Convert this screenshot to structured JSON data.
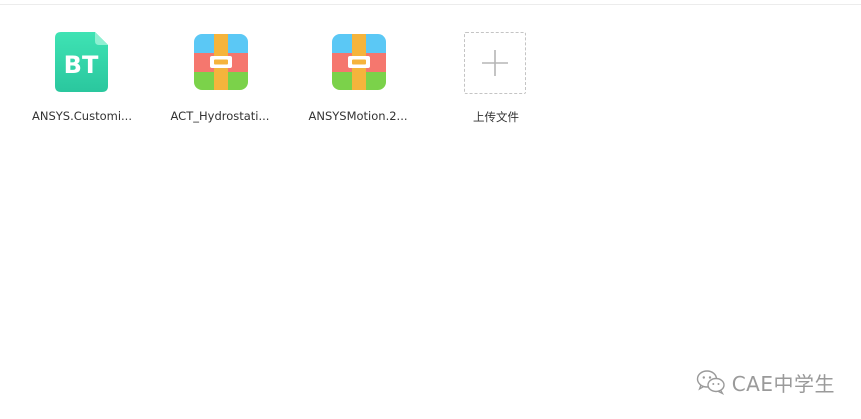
{
  "files": [
    {
      "name": "ANSYS.Customi...",
      "icon": "bt-torrent-icon",
      "icon_text": "BT"
    },
    {
      "name": "ACT_Hydrostati...",
      "icon": "archive-icon"
    },
    {
      "name": "ANSYSMotion.2...",
      "icon": "archive-icon"
    }
  ],
  "upload": {
    "label": "上传文件",
    "icon": "plus-icon"
  },
  "watermark": {
    "text": "CAE中学生",
    "icon": "wechat-icon"
  },
  "colors": {
    "bt_gradient_top": "#3ee0b0",
    "bt_gradient_bottom": "#2bc9a0",
    "archive_blue": "#5bc8f5",
    "archive_red": "#f5776e",
    "archive_green": "#7bd24a",
    "archive_strap": "#f5b43c",
    "text": "#333333",
    "watermark": "#9a9a9a"
  }
}
